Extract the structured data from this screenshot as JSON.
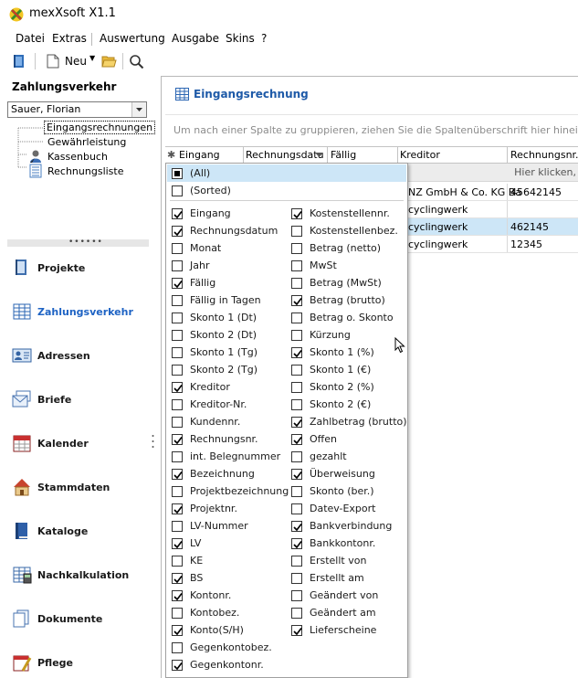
{
  "app": {
    "title": "mexXsoft X1.1"
  },
  "menu": {
    "items": [
      "Datei",
      "Extras",
      "Auswertung",
      "Ausgabe",
      "Skins",
      "?"
    ]
  },
  "toolbar": {
    "new_label": "Neu"
  },
  "left": {
    "section_title": "Zahlungsverkehr",
    "user": "Sauer, Florian",
    "tree": [
      "Eingangsrechnungen",
      "Gewährleistung",
      "Kassenbuch",
      "Rechnungsliste"
    ],
    "nav": [
      "Projekte",
      "Zahlungsverkehr",
      "Adressen",
      "Briefe",
      "Kalender",
      "Stammdaten",
      "Kataloge",
      "Nachkalkulation",
      "Dokumente",
      "Pflege"
    ]
  },
  "main": {
    "title": "Eingangsrechnung",
    "group_hint": "Um nach einer Spalte zu gruppieren, ziehen Sie die Spaltenüberschrift hier hinein",
    "columns": [
      "Eingang",
      "Rechnungsdatu",
      "Fällig",
      "Kreditor",
      "Rechnungsnr."
    ],
    "filter_hint": "Hier klicken,",
    "rows": [
      {
        "kreditor": "NZ GmbH & Co. KG Ba",
        "nr": "45642145"
      },
      {
        "kreditor": "cyclingwerk",
        "nr": ""
      },
      {
        "kreditor": "cyclingwerk",
        "nr": "462145"
      },
      {
        "kreditor": "cyclingwerk",
        "nr": "12345"
      }
    ]
  },
  "popup": {
    "all_label": "(All)",
    "sorted_label": "(Sorted)",
    "left_items": [
      {
        "label": "Eingang",
        "checked": true
      },
      {
        "label": "Rechnungsdatum",
        "checked": true
      },
      {
        "label": "Monat",
        "checked": false
      },
      {
        "label": "Jahr",
        "checked": false
      },
      {
        "label": "Fällig",
        "checked": true
      },
      {
        "label": "Fällig in Tagen",
        "checked": false
      },
      {
        "label": "Skonto 1 (Dt)",
        "checked": false
      },
      {
        "label": "Skonto 2 (Dt)",
        "checked": false
      },
      {
        "label": "Skonto 1 (Tg)",
        "checked": false
      },
      {
        "label": "Skonto 2 (Tg)",
        "checked": false
      },
      {
        "label": "Kreditor",
        "checked": true
      },
      {
        "label": "Kreditor-Nr.",
        "checked": false
      },
      {
        "label": "Kundennr.",
        "checked": false
      },
      {
        "label": "Rechnungsnr.",
        "checked": true
      },
      {
        "label": "int. Belegnummer",
        "checked": false
      },
      {
        "label": "Bezeichnung",
        "checked": true
      },
      {
        "label": "Projektbezeichnung",
        "checked": false
      },
      {
        "label": "Projektnr.",
        "checked": true
      },
      {
        "label": "LV-Nummer",
        "checked": false
      },
      {
        "label": "LV",
        "checked": true
      },
      {
        "label": "KE",
        "checked": false
      },
      {
        "label": "BS",
        "checked": true
      },
      {
        "label": "Kontonr.",
        "checked": true
      },
      {
        "label": "Kontobez.",
        "checked": false
      },
      {
        "label": "Konto(S/H)",
        "checked": true
      },
      {
        "label": "Gegenkontobez.",
        "checked": false
      },
      {
        "label": "Gegenkontonr.",
        "checked": true
      }
    ],
    "right_items": [
      {
        "label": "Kostenstellennr.",
        "checked": true
      },
      {
        "label": "Kostenstellenbez.",
        "checked": false
      },
      {
        "label": "Betrag (netto)",
        "checked": false
      },
      {
        "label": "MwSt",
        "checked": false
      },
      {
        "label": "Betrag (MwSt)",
        "checked": false
      },
      {
        "label": "Betrag (brutto)",
        "checked": true
      },
      {
        "label": "Betrag o. Skonto",
        "checked": false
      },
      {
        "label": "Kürzung",
        "checked": false
      },
      {
        "label": "Skonto 1 (%)",
        "checked": true
      },
      {
        "label": "Skonto 1 (€)",
        "checked": false
      },
      {
        "label": "Skonto 2 (%)",
        "checked": false
      },
      {
        "label": "Skonto 2 (€)",
        "checked": false
      },
      {
        "label": "Zahlbetrag (brutto)",
        "checked": true
      },
      {
        "label": "Offen",
        "checked": true
      },
      {
        "label": "gezahlt",
        "checked": false
      },
      {
        "label": "Überweisung",
        "checked": true
      },
      {
        "label": "Skonto (ber.)",
        "checked": false
      },
      {
        "label": "Datev-Export",
        "checked": false
      },
      {
        "label": "Bankverbindung",
        "checked": true
      },
      {
        "label": "Bankkontonr.",
        "checked": true
      },
      {
        "label": "Erstellt von",
        "checked": false
      },
      {
        "label": "Erstellt am",
        "checked": false
      },
      {
        "label": "Geändert von",
        "checked": false
      },
      {
        "label": "Geändert am",
        "checked": false
      },
      {
        "label": "Lieferscheine",
        "checked": true
      }
    ]
  }
}
